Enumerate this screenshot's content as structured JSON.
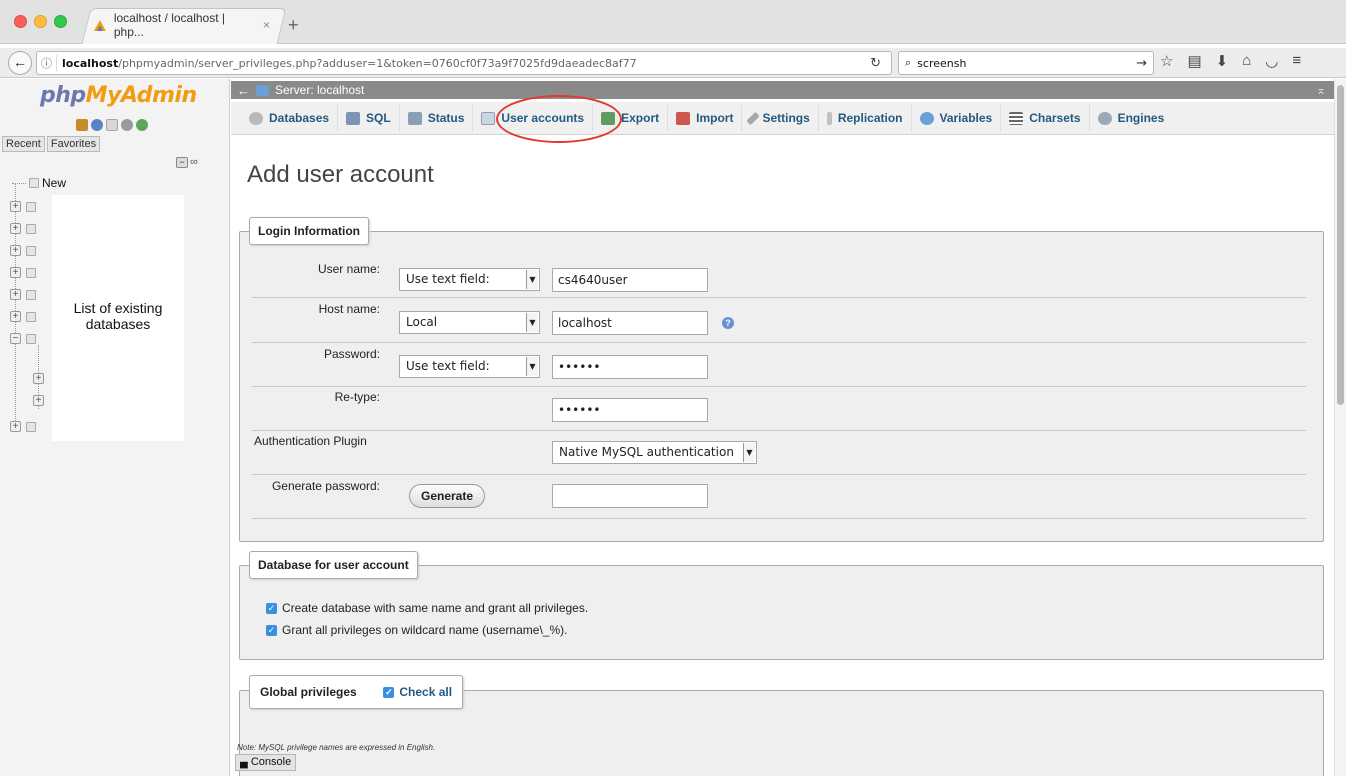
{
  "browser": {
    "tab_title": "localhost / localhost | php...",
    "tab_close": "×",
    "new_tab": "+",
    "url_host": "localhost",
    "url_path": "/phpmyadmin/server_privileges.php?adduser=1&token=0760cf0f73a9f7025fd9daeadec8af77",
    "search_value": "screensh",
    "icons": [
      "back-arrow-icon",
      "info-icon",
      "reload-icon",
      "search-icon",
      "search-go-icon",
      "bookmark-star-icon",
      "reading-list-icon",
      "download-icon",
      "home-icon",
      "pocket-icon",
      "menu-icon"
    ]
  },
  "sidebar": {
    "logo_php": "php",
    "logo_myadmin": "MyAdmin",
    "tabs": [
      "Recent",
      "Favorites"
    ],
    "new_label": "New",
    "annotation": "List of existing databases"
  },
  "main": {
    "server_label": "Server: localhost",
    "menu": [
      {
        "label": "Databases",
        "icon": "databases-icon",
        "color": "#b9b9b9"
      },
      {
        "label": "SQL",
        "icon": "sql-icon",
        "color": "#7c95b5"
      },
      {
        "label": "Status",
        "icon": "status-icon",
        "color": "#8aa0b6"
      },
      {
        "label": "User accounts",
        "icon": "user-accounts-icon",
        "color": "#c8d6e2"
      },
      {
        "label": "Export",
        "icon": "export-icon",
        "color": "#5e9b5e"
      },
      {
        "label": "Import",
        "icon": "import-icon",
        "color": "#d0574c"
      },
      {
        "label": "Settings",
        "icon": "settings-icon",
        "color": "#a8a8a8"
      },
      {
        "label": "Replication",
        "icon": "replication-icon",
        "color": "#c1c1c1"
      },
      {
        "label": "Variables",
        "icon": "variables-icon",
        "color": "#6aa0d6"
      },
      {
        "label": "Charsets",
        "icon": "charsets-icon",
        "color": "#666666"
      },
      {
        "label": "Engines",
        "icon": "engines-icon",
        "color": "#9aa9b8"
      }
    ],
    "page_title": "Add user account",
    "login": {
      "legend": "Login Information",
      "username_label": "User name:",
      "username_mode": "Use text field:",
      "username_value": "cs4640user",
      "host_label": "Host name:",
      "host_mode": "Local",
      "host_value": "localhost",
      "password_label": "Password:",
      "password_mode": "Use text field:",
      "password_value": "••••••",
      "retype_label": "Re-type:",
      "retype_value": "••••••",
      "auth_label": "Authentication Plugin",
      "auth_value": "Native MySQL authentication",
      "generate_label": "Generate password:",
      "generate_button": "Generate",
      "generate_value": ""
    },
    "database": {
      "legend": "Database for user account",
      "option1": "Create database with same name and grant all privileges.",
      "option2": "Grant all privileges on wildcard name (username\\_%)."
    },
    "global": {
      "legend": "Global privileges",
      "check_all": "Check all",
      "note": "Note: MySQL privilege names are expressed in English."
    },
    "console": "Console"
  },
  "colors": {
    "accent_link": "#235a81",
    "highlight": "#e03a2e",
    "checkbox": "#3b8fe0",
    "logo_php": "#6c78af",
    "logo_myadmin": "#f29c10"
  }
}
